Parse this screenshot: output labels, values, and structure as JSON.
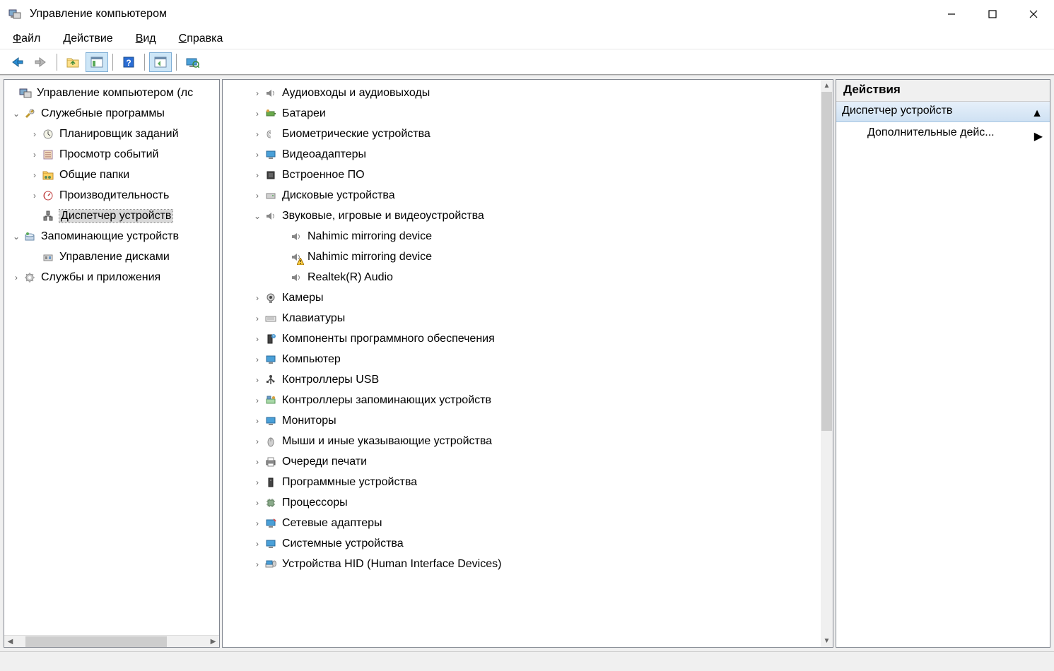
{
  "window": {
    "title": "Управление компьютером"
  },
  "menu": {
    "file": "Файл",
    "action": "Действие",
    "view": "Вид",
    "help": "Справка"
  },
  "leftTree": {
    "root": "Управление компьютером (лс",
    "systemTools": "Служебные программы",
    "scheduler": "Планировщик заданий",
    "eventViewer": "Просмотр событий",
    "sharedFolders": "Общие папки",
    "performance": "Производительность",
    "deviceManager": "Диспетчер устройств",
    "storage": "Запоминающие устройств",
    "diskMgmt": "Управление дисками",
    "services": "Службы и приложения"
  },
  "devices": {
    "audioIO": "Аудиовходы и аудиовыходы",
    "batteries": "Батареи",
    "biometric": "Биометрические устройства",
    "display": "Видеоадаптеры",
    "firmware": "Встроенное ПО",
    "disks": "Дисковые устройства",
    "sound": "Звуковые, игровые и видеоустройства",
    "nahimic1": "Nahimic mirroring device",
    "nahimic2": "Nahimic mirroring device",
    "realtek": "Realtek(R) Audio",
    "cameras": "Камеры",
    "keyboards": "Клавиатуры",
    "swComponents": "Компоненты программного обеспечения",
    "computer": "Компьютер",
    "usb": "Контроллеры USB",
    "storageCtrl": "Контроллеры запоминающих устройств",
    "monitors": "Мониторы",
    "mice": "Мыши и иные указывающие устройства",
    "printQueues": "Очереди печати",
    "swDevices": "Программные устройства",
    "processors": "Процессоры",
    "network": "Сетевые адаптеры",
    "system": "Системные устройства",
    "hid": "Устройства HID (Human Interface Devices)"
  },
  "actions": {
    "header": "Действия",
    "sub": "Диспетчер устройств",
    "more": "Дополнительные дейс..."
  }
}
